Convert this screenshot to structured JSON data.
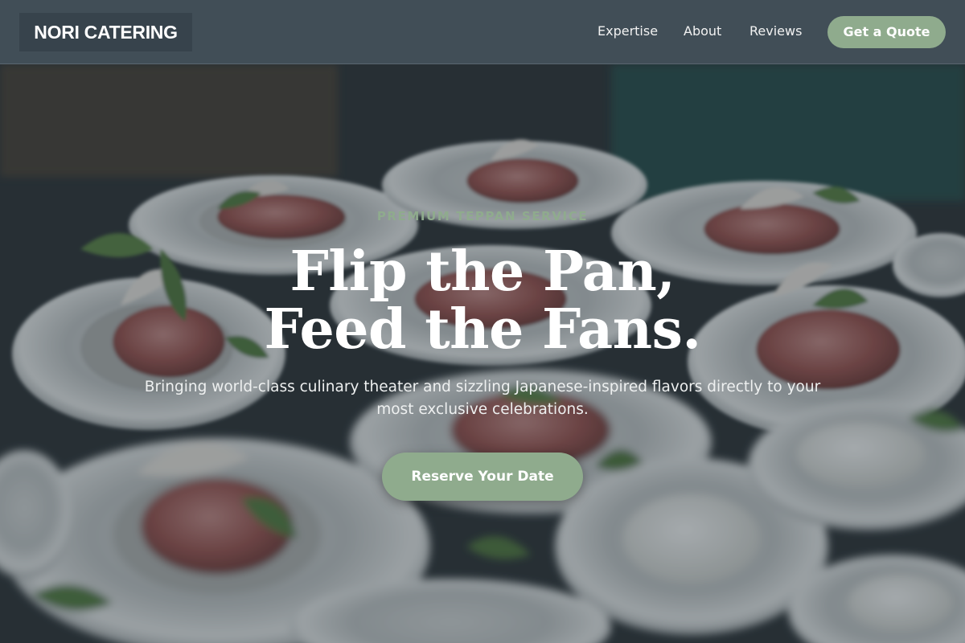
{
  "brand": {
    "name": "NORI CATERING"
  },
  "nav": {
    "links": [
      {
        "label": "Expertise"
      },
      {
        "label": "About"
      },
      {
        "label": "Reviews"
      }
    ],
    "cta_label": "Get a Quote"
  },
  "hero": {
    "eyebrow": "PREMIUM TEPPAN SERVICE",
    "headline_line1": "Flip the Pan,",
    "headline_line2": "Feed the Fans.",
    "subtext": "Bringing world-class culinary theater and sizzling Japanese-inspired flavors directly to your most exclusive celebrations.",
    "cta_label": "Reserve Your Date",
    "background_image": "plated appetizers with cured meat and microgreens in white bowls"
  },
  "colors": {
    "accent": "#8fab8d",
    "nav_bg": "#414e57",
    "logo_bg": "#37434c",
    "overlay": "rgba(40,52,60,0.42)"
  }
}
